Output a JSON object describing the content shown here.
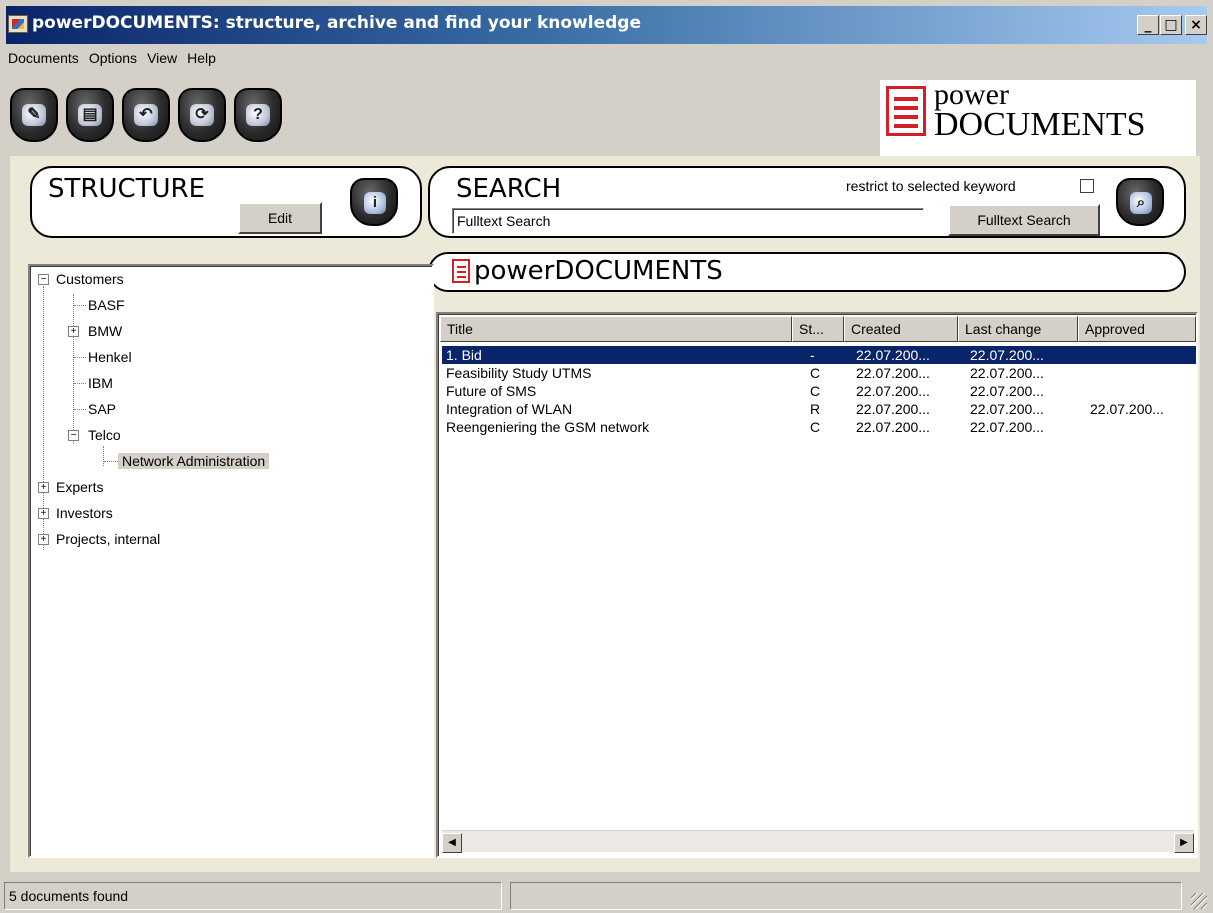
{
  "window": {
    "title": "powerDOCUMENTS: structure, archive and find your knowledge",
    "minimize": "_",
    "maximize": "□",
    "close": "×"
  },
  "menu": [
    "Documents",
    "Options",
    "View",
    "Help"
  ],
  "toolbar": {
    "buttons": [
      {
        "icon": "write-icon",
        "glyph": "✎"
      },
      {
        "icon": "document-icon",
        "glyph": "▤"
      },
      {
        "icon": "back-icon",
        "glyph": "↶"
      },
      {
        "icon": "refresh-icon",
        "glyph": "⟳"
      },
      {
        "icon": "help-icon",
        "glyph": "?"
      }
    ]
  },
  "logo": {
    "line1": "power",
    "line2": "DOCUMENTS"
  },
  "structure": {
    "title": "STRUCTURE",
    "edit_label": "Edit",
    "icon": "info-icon",
    "icon_glyph": "i"
  },
  "search": {
    "title": "SEARCH",
    "restrict_label": "restrict to selected keyword",
    "input_value": "Fulltext Search",
    "button_label": "Fulltext Search",
    "icon": "search-icon",
    "icon_glyph": "⌕"
  },
  "folder_banner": {
    "label": "powerDOCUMENTS"
  },
  "tree": {
    "customers": "Customers",
    "basf": "BASF",
    "bmw": "BMW",
    "henkel": "Henkel",
    "ibm": "IBM",
    "sap": "SAP",
    "telco": "Telco",
    "network": "Network Administration",
    "experts": "Experts",
    "investors": "Investors",
    "projects": "Projects, internal"
  },
  "table": {
    "columns": [
      "Title",
      "St...",
      "Created",
      "Last change",
      "Approved"
    ],
    "rows": [
      {
        "title": "1. Bid",
        "status": "-",
        "created": "22.07.200...",
        "changed": "22.07.200...",
        "approved": ""
      },
      {
        "title": "Feasibility Study UTMS",
        "status": "C",
        "created": "22.07.200...",
        "changed": "22.07.200...",
        "approved": ""
      },
      {
        "title": "Future of SMS",
        "status": "C",
        "created": "22.07.200...",
        "changed": "22.07.200...",
        "approved": ""
      },
      {
        "title": "Integration of WLAN",
        "status": "R",
        "created": "22.07.200...",
        "changed": "22.07.200...",
        "approved": "22.07.200..."
      },
      {
        "title": "Reengeniering the GSM network",
        "status": "C",
        "created": "22.07.200...",
        "changed": "22.07.200...",
        "approved": ""
      }
    ]
  },
  "status": {
    "left": "5 documents found",
    "right": ""
  },
  "colors": {
    "selection": "#0a246a",
    "titlebar": "#0a246a",
    "logo_red": "#d41f26"
  }
}
